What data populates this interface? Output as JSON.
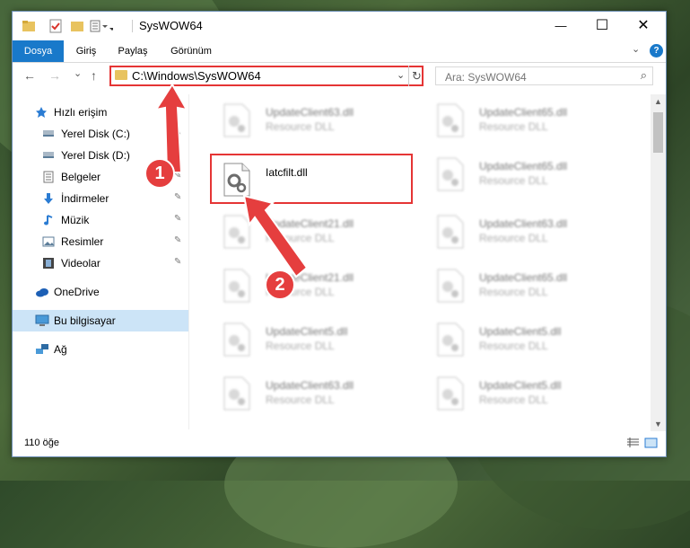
{
  "window": {
    "title": "SysWOW64",
    "minimize_glyph": "—",
    "maximize_glyph": "☐",
    "close_glyph": "✕"
  },
  "ribbon": {
    "tabs": [
      "Dosya",
      "Giriş",
      "Paylaş",
      "Görünüm"
    ],
    "expand_glyph": "⌄",
    "help_glyph": "?"
  },
  "nav": {
    "back_glyph": "←",
    "forward_glyph": "→",
    "recent_glyph": "⌄",
    "up_glyph": "↑",
    "address_path": "C:\\Windows\\SysWOW64",
    "dropdown_glyph": "⌄",
    "refresh_glyph": "↻",
    "search_placeholder": "Ara: SysWOW64",
    "search_glyph": "⌕"
  },
  "sidebar": {
    "items": [
      {
        "label": "Hızlı erişim",
        "icon": "star-icon",
        "pinned": false
      },
      {
        "label": "Yerel Disk (C:)",
        "icon": "drive-icon",
        "pinned": true
      },
      {
        "label": "Yerel Disk (D:)",
        "icon": "drive-icon",
        "pinned": true
      },
      {
        "label": "Belgeler",
        "icon": "documents-icon",
        "pinned": true
      },
      {
        "label": "İndirmeler",
        "icon": "download-icon",
        "pinned": true
      },
      {
        "label": "Müzik",
        "icon": "music-icon",
        "pinned": true
      },
      {
        "label": "Resimler",
        "icon": "pictures-icon",
        "pinned": true
      },
      {
        "label": "Videolar",
        "icon": "videos-icon",
        "pinned": true
      },
      {
        "label": "OneDrive",
        "icon": "cloud-icon",
        "pinned": false
      },
      {
        "label": "Bu bilgisayar",
        "icon": "computer-icon",
        "pinned": false
      },
      {
        "label": "Ağ",
        "icon": "network-icon",
        "pinned": false
      }
    ],
    "pin_glyph": "📌"
  },
  "files": {
    "highlighted": {
      "name": "Iatcfilt.dll"
    },
    "background": [
      {
        "name": "UpdateClient63.dll",
        "type": "Resource DLL"
      },
      {
        "name": "UpdateClient65.dll",
        "type": "Resource DLL"
      },
      {
        "name": "UpdateClient65.dll",
        "type": "Resource DLL"
      },
      {
        "name": "UpdateClient21.dll",
        "type": "Resource DLL"
      },
      {
        "name": "UpdateClient63.dll",
        "type": "Resource DLL"
      },
      {
        "name": "UpdateClient21.dll",
        "type": "Resource DLL"
      },
      {
        "name": "UpdateClient65.dll",
        "type": "Resource DLL"
      },
      {
        "name": "UpdateClient5.dll",
        "type": "Resource DLL"
      },
      {
        "name": "UpdateClient5.dll",
        "type": "Resource DLL"
      },
      {
        "name": "UpdateClient63.dll",
        "type": "Resource DLL"
      },
      {
        "name": "UpdateClient5.dll",
        "type": "Resource DLL"
      }
    ]
  },
  "status": {
    "item_count": "110 öğe"
  },
  "annotations": {
    "badge1": "1",
    "badge2": "2"
  },
  "colors": {
    "accent": "#1979ca",
    "annotation": "#e53535",
    "selected": "#cce4f7"
  }
}
